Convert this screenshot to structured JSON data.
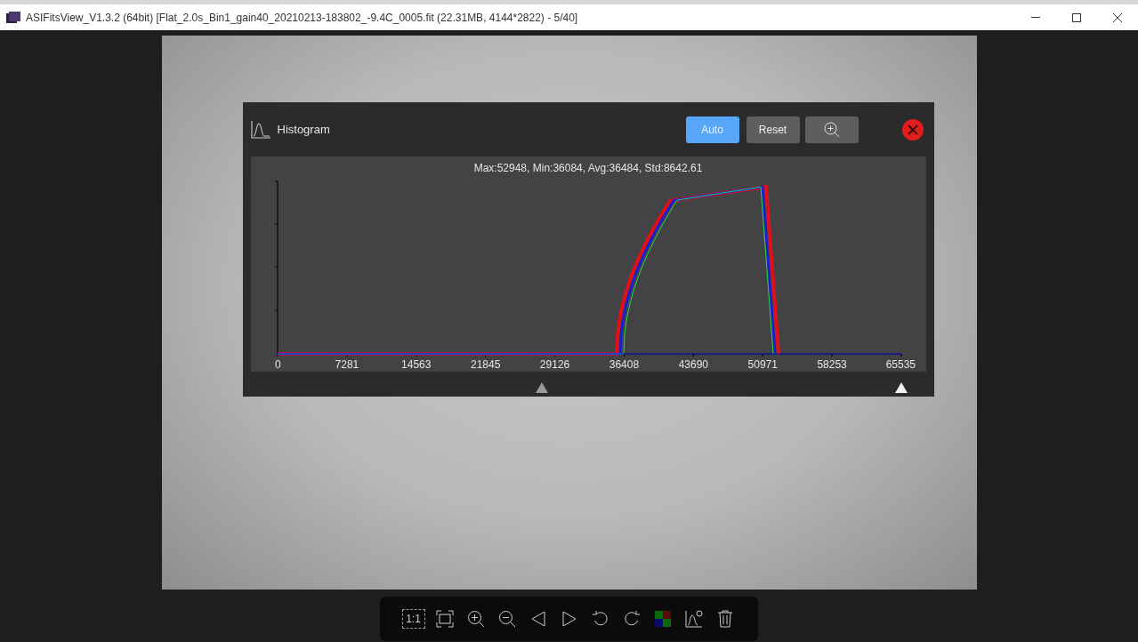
{
  "window": {
    "title": "ASIFitsView_V1.3.2 (64bit) [Flat_2.0s_Bin1_gain40_20210213-183802_-9.4C_0005.fit (22.31MB, 4144*2822) - 5/40]"
  },
  "histogram": {
    "title": "Histogram",
    "buttons": [
      {
        "label": "Auto",
        "selected": true
      },
      {
        "label": "Reset",
        "selected": false
      }
    ],
    "stats": "Max:52948, Min:36084, Avg:36484, Std:8642.61",
    "x_ticks": [
      "0",
      "7281",
      "14563",
      "21845",
      "29126",
      "36408",
      "43690",
      "50971",
      "58253",
      "65535"
    ],
    "black_point": {
      "level": 0.425
    },
    "white_point": {
      "level": 1.0
    }
  },
  "toolbar": {
    "actual_size_label": "1:1"
  }
}
